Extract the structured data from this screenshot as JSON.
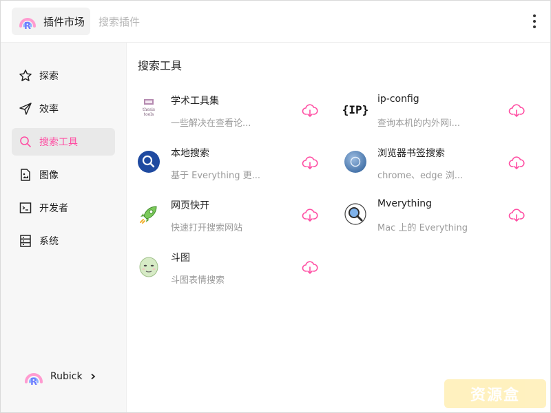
{
  "header": {
    "app_title": "插件市场",
    "search_placeholder": "搜索插件"
  },
  "sidebar": {
    "items": [
      {
        "label": "探索",
        "icon": "star-icon",
        "active": false
      },
      {
        "label": "效率",
        "icon": "send-icon",
        "active": false
      },
      {
        "label": "搜索工具",
        "icon": "search-icon",
        "active": true
      },
      {
        "label": "图像",
        "icon": "image-file-icon",
        "active": false
      },
      {
        "label": "开发者",
        "icon": "terminal-icon",
        "active": false
      },
      {
        "label": "系统",
        "icon": "database-icon",
        "active": false
      }
    ],
    "user": {
      "name": "Rubick",
      "icon": "chevron-right-icon"
    }
  },
  "main": {
    "section_title": "搜索工具",
    "plugins": [
      {
        "name": "学术工具集",
        "desc": "一些解决在查看论...",
        "icon": "thesis-tools-icon",
        "icon_text": "thesis tools"
      },
      {
        "name": "ip-config",
        "desc": "查询本机的内外网i...",
        "icon": "ip-icon",
        "icon_text": "{IP}"
      },
      {
        "name": "本地搜索",
        "desc": "基于 Everything 更...",
        "icon": "local-search-icon"
      },
      {
        "name": "浏览器书签搜索",
        "desc": "chrome、edge 浏...",
        "icon": "bookmark-search-icon"
      },
      {
        "name": "网页快开",
        "desc": "快速打开搜索网站",
        "icon": "rocket-icon"
      },
      {
        "name": "Mverything",
        "desc": "Mac 上的 Everything",
        "icon": "magnifier-icon"
      },
      {
        "name": "斗图",
        "desc": "斗图表情搜索",
        "icon": "meme-face-icon"
      }
    ],
    "download_icon": "cloud-download-icon"
  },
  "colors": {
    "accent": "#ff4ea3",
    "sidebar_bg": "#f7f7f7",
    "active_bg": "#e9e9e9",
    "desc_text": "#9a9a9a"
  },
  "watermark": {
    "text": "资源盒"
  }
}
